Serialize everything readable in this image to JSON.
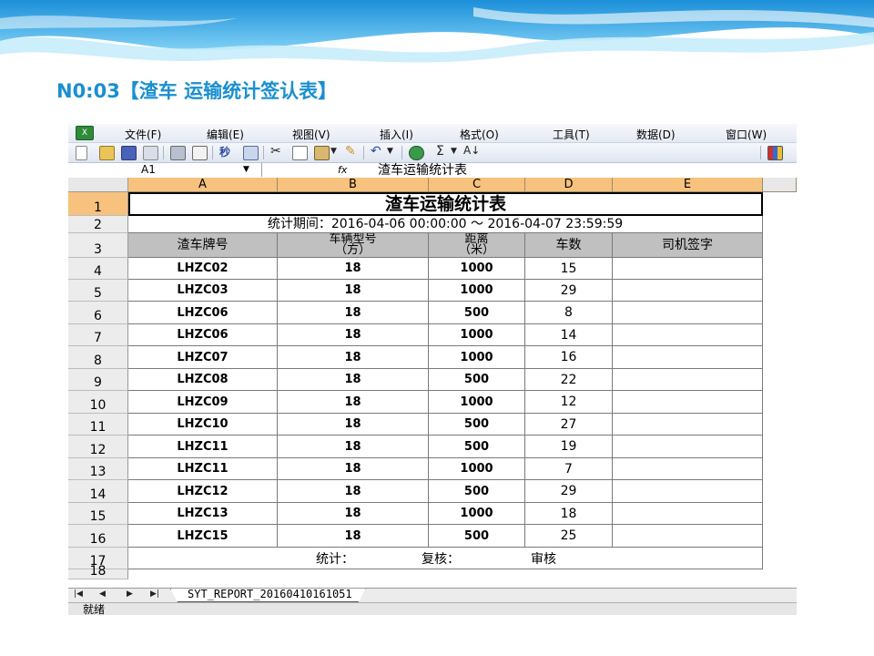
{
  "slide": {
    "title": "N0:03【渣车 运输统计签认表】"
  },
  "excel": {
    "menu": [
      "文件(F)",
      "编辑(E)",
      "视图(V)",
      "插入(I)",
      "格式(O)",
      "工具(T)",
      "数据(D)",
      "窗口(W)"
    ],
    "name_box": "A1",
    "fx_label": "fx",
    "formula": "渣车运输统计表",
    "columns": [
      "A",
      "B",
      "C",
      "D",
      "E"
    ],
    "rows": [
      "1",
      "2",
      "3",
      "4",
      "5",
      "6",
      "7",
      "8",
      "9",
      "10",
      "11",
      "12",
      "13",
      "14",
      "15",
      "16",
      "17",
      "18"
    ],
    "sheet_title": "渣车运输统计表",
    "period": "统计期间：2016-04-06 00:00:00 ～ 2016-04-07 23:59:59",
    "headers": {
      "plate": "渣车牌号",
      "model_line1": "车辆型号",
      "model_line2": "（方）",
      "distance_line1": "距离",
      "distance_line2": "（米）",
      "count": "车数",
      "signature": "司机签字"
    },
    "data_rows": [
      {
        "plate": "LHZC02",
        "model": "18",
        "distance": "1000",
        "count": "15"
      },
      {
        "plate": "LHZC03",
        "model": "18",
        "distance": "1000",
        "count": "29"
      },
      {
        "plate": "LHZC06",
        "model": "18",
        "distance": "500",
        "count": "8"
      },
      {
        "plate": "LHZC06",
        "model": "18",
        "distance": "1000",
        "count": "14"
      },
      {
        "plate": "LHZC07",
        "model": "18",
        "distance": "1000",
        "count": "16"
      },
      {
        "plate": "LHZC08",
        "model": "18",
        "distance": "500",
        "count": "22"
      },
      {
        "plate": "LHZC09",
        "model": "18",
        "distance": "1000",
        "count": "12"
      },
      {
        "plate": "LHZC10",
        "model": "18",
        "distance": "500",
        "count": "27"
      },
      {
        "plate": "LHZC11",
        "model": "18",
        "distance": "500",
        "count": "19"
      },
      {
        "plate": "LHZC11",
        "model": "18",
        "distance": "1000",
        "count": "7"
      },
      {
        "plate": "LHZC12",
        "model": "18",
        "distance": "500",
        "count": "29"
      },
      {
        "plate": "LHZC13",
        "model": "18",
        "distance": "1000",
        "count": "18"
      },
      {
        "plate": "LHZC15",
        "model": "18",
        "distance": "500",
        "count": "25"
      }
    ],
    "footer": {
      "stat": "统计：",
      "review": "复核：",
      "audit": "审核"
    },
    "sheet_nav": [
      "first-sheet",
      "prev-sheet",
      "next-sheet",
      "last-sheet"
    ],
    "sheet_tab": "SYT_REPORT_20160410161051",
    "status": "就绪"
  },
  "colors": {
    "title": "#1a8fd0",
    "column_header": "#f6c27d",
    "table_header": "#c0c0c0",
    "banner": "#2a9ee0"
  }
}
